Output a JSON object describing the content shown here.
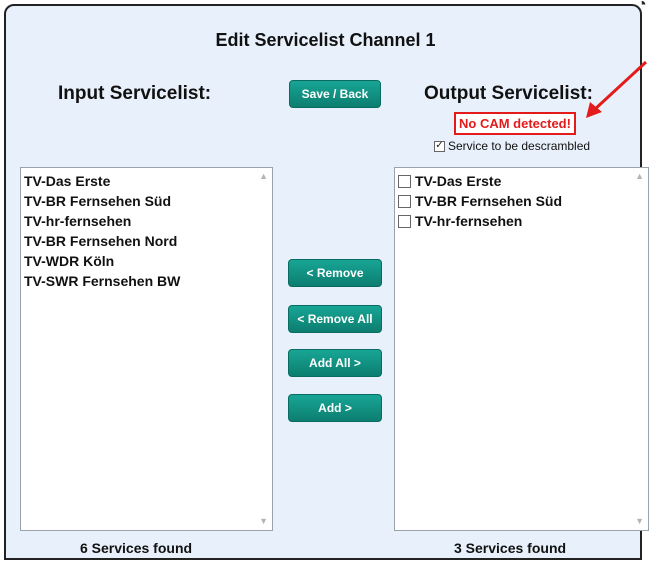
{
  "title": "Edit Servicelist Channel 1",
  "input_heading": "Input Servicelist:",
  "output_heading": "Output Servicelist:",
  "buttons": {
    "save": "Save / Back",
    "remove": "< Remove",
    "remove_all": "< Remove All",
    "add_all": "Add All >",
    "add": "Add >"
  },
  "no_cam": "No CAM detected!",
  "descramble_label": "Service to be descrambled",
  "descramble_checked": true,
  "input_services": [
    "TV-Das Erste",
    "TV-BR Fernsehen Süd",
    "TV-hr-fernsehen",
    "TV-BR Fernsehen Nord",
    "TV-WDR Köln",
    "TV-SWR Fernsehen BW"
  ],
  "output_services": [
    "TV-Das Erste",
    "TV-BR Fernsehen Süd",
    "TV-hr-fernsehen"
  ],
  "input_count": "6 Services found",
  "output_count": "3 Services found",
  "colors": {
    "button": "#0c7e70",
    "warning": "#e31b1b",
    "panel": "#e8f1fb"
  }
}
